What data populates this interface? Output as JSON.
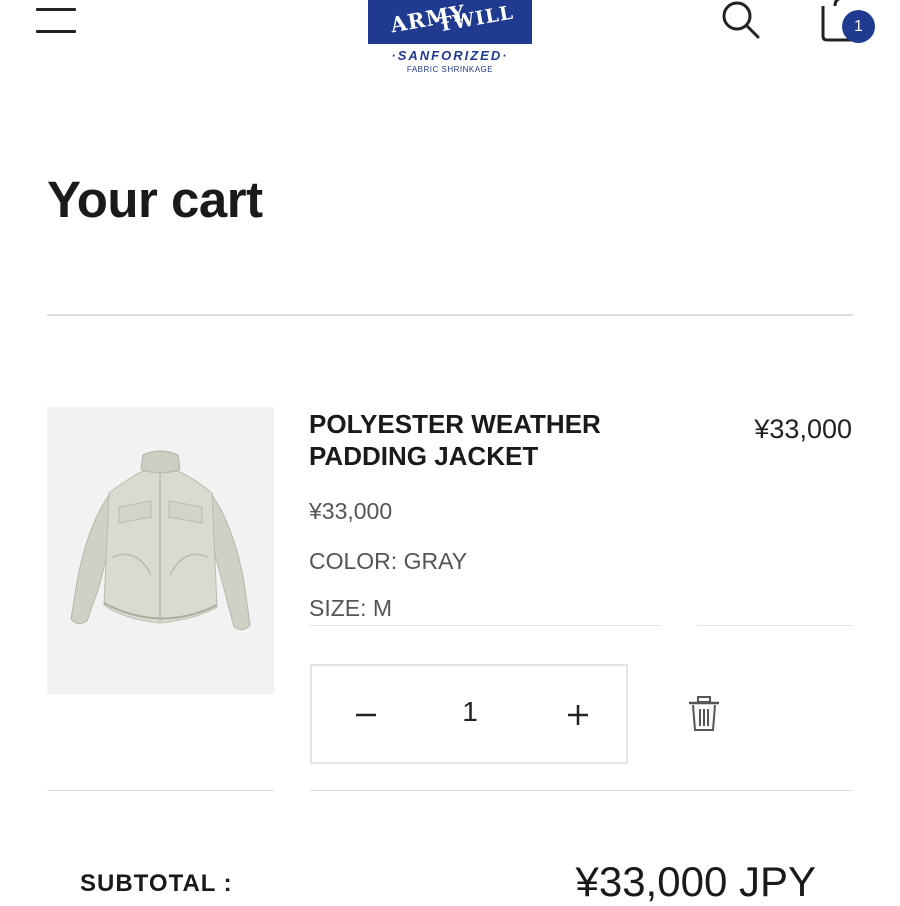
{
  "header": {
    "menu_icon": "hamburger-menu-icon",
    "logo": {
      "line1": "ARMY",
      "line2": "TWILL",
      "line3": "·SANFORIZED·",
      "line4": "FABRIC SHRINKAGE"
    },
    "search_icon": "search-icon",
    "cart_icon": "shopping-bag-icon",
    "cart_count": "1",
    "accent_color": "#1f3a8f"
  },
  "page": {
    "title": "Your cart"
  },
  "cart": {
    "items": [
      {
        "name": "POLYESTER WEATHER PADDING JACKET",
        "line_price": "¥33,000",
        "unit_price": "¥33,000",
        "color": "COLOR: GRAY",
        "size": "SIZE: M",
        "quantity": "1",
        "image_icon": "gray-padded-jacket-image"
      }
    ]
  },
  "summary": {
    "subtotal_label": "SUBTOTAL :",
    "subtotal_value": "¥33,000 JPY"
  }
}
